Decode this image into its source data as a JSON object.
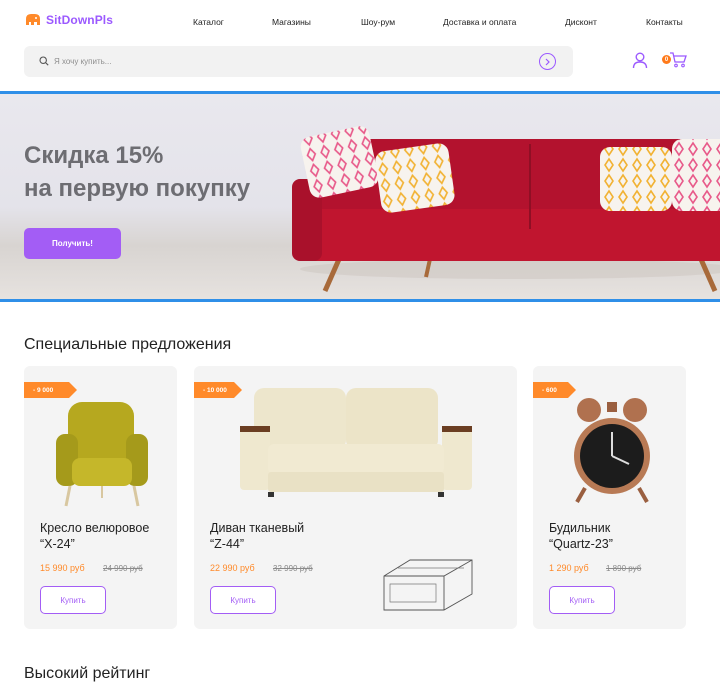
{
  "header": {
    "logo": "SitDownPls",
    "nav": [
      "Каталог",
      "Магазины",
      "Шоу-рум",
      "Доставка и оплата",
      "Дисконт",
      "Контакты"
    ]
  },
  "search": {
    "placeholder": "Я хочу купить..."
  },
  "cart": {
    "count": "0"
  },
  "hero": {
    "title_line1": "Скидка 15%",
    "title_line2": "на первую покупку",
    "button": "Получить!"
  },
  "special": {
    "title": "Специальные предложения",
    "cards": [
      {
        "discount": "- 9 000",
        "name_line1": "Кресло велюровое",
        "name_line2": "“X-24”",
        "price": "15 990 руб",
        "old_price": "24 990 руб",
        "button": "Купить"
      },
      {
        "discount": "- 10 000",
        "name_line1": "Диван тканевый",
        "name_line2": "“Z-44”",
        "price": "22 990 руб",
        "old_price": "32 990 руб",
        "button": "Купить"
      },
      {
        "discount": "- 600",
        "name_line1": "Будильник",
        "name_line2": "“Quartz-23”",
        "price": "1 290 руб",
        "old_price": "1 890 руб",
        "button": "Купить"
      }
    ]
  },
  "rating": {
    "title": "Высокий рейтинг"
  },
  "colors": {
    "accent": "#a35df5",
    "orange": "#ff8a2a",
    "hero_border": "#2f8fe8"
  }
}
